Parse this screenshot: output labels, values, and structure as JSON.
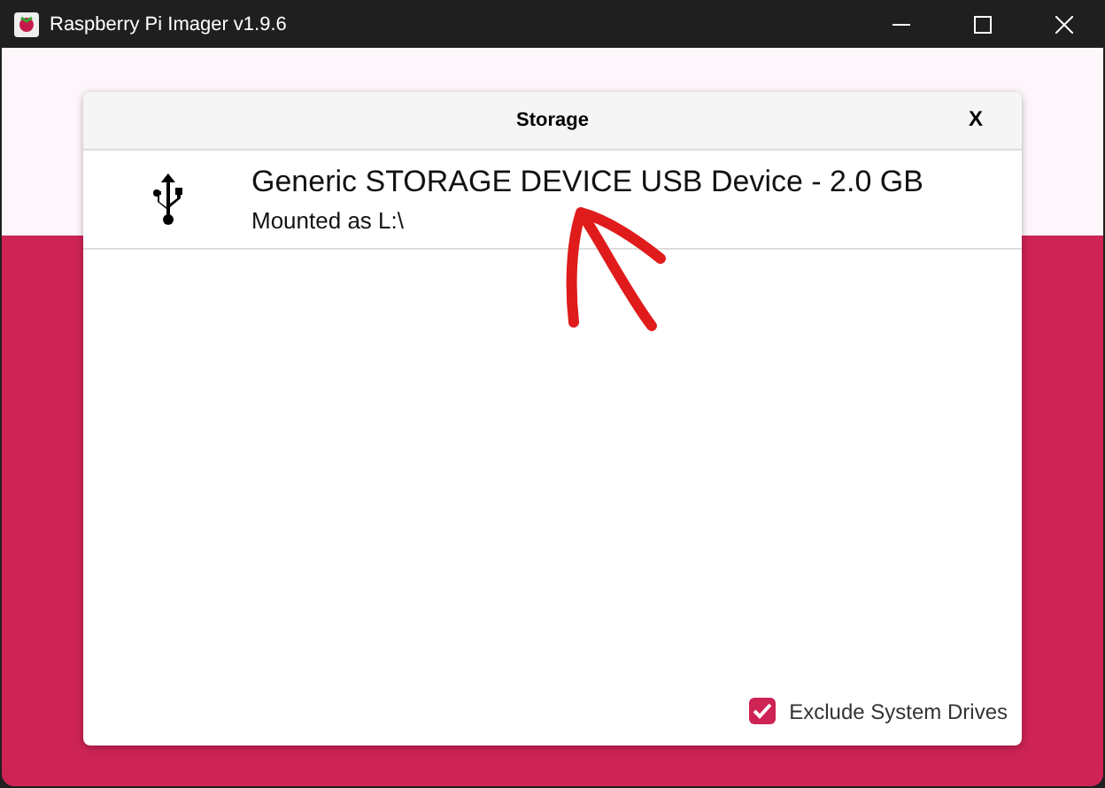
{
  "window": {
    "title": "Raspberry Pi Imager v1.9.6"
  },
  "dialog": {
    "title": "Storage",
    "close": "X",
    "devices": [
      {
        "name": "Generic STORAGE DEVICE USB Device - 2.0 GB",
        "detail": "Mounted as L:\\",
        "selected": false
      }
    ],
    "exclude_system_drives": {
      "label": "Exclude System Drives",
      "checked": true
    }
  }
}
